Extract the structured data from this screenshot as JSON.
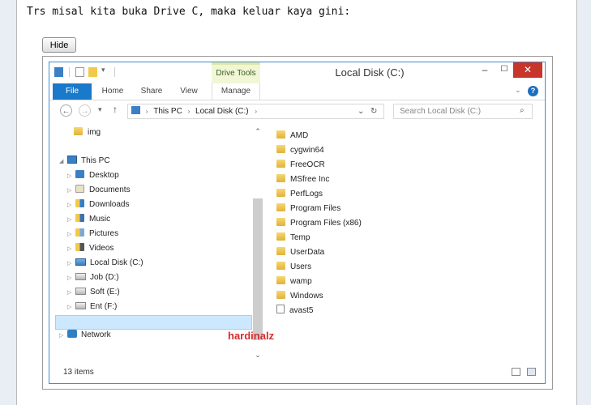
{
  "post": {
    "text": "Trs misal kita buka Drive C, maka keluar kaya gini:"
  },
  "spoiler": {
    "hide_label": "Hide"
  },
  "window": {
    "contextual_tab": "Drive Tools",
    "title": "Local Disk (C:)",
    "controls": {
      "minimize": "–",
      "maximize": "☐",
      "close": "✕"
    },
    "tabs": [
      "File",
      "Home",
      "Share",
      "View",
      "Manage"
    ],
    "help": "?"
  },
  "address": {
    "back": "←",
    "forward": "→",
    "recent": "▾",
    "up": "↑",
    "path": [
      "This PC",
      "Local Disk (C:)"
    ],
    "dropdown": "⌄",
    "refresh": "↻",
    "search_placeholder": "Search Local Disk (C:)"
  },
  "nav_pane": {
    "items": [
      {
        "label": "img"
      },
      {
        "label": "This PC"
      },
      {
        "label": "Desktop"
      },
      {
        "label": "Documents"
      },
      {
        "label": "Downloads"
      },
      {
        "label": "Music"
      },
      {
        "label": "Pictures"
      },
      {
        "label": "Videos"
      },
      {
        "label": "Local Disk (C:)"
      },
      {
        "label": "Job (D:)"
      },
      {
        "label": "Soft (E:)"
      },
      {
        "label": "Ent (F:)"
      },
      {
        "label": "Network"
      }
    ]
  },
  "files": [
    "AMD",
    "cygwin64",
    "FreeOCR",
    "MSfree Inc",
    "PerfLogs",
    "Program Files",
    "Program Files (x86)",
    "Temp",
    "UserData",
    "Users",
    "wamp",
    "Windows",
    "avast5"
  ],
  "watermark": "hardinalz",
  "status": {
    "count": "13 items"
  },
  "colors": {
    "accent": "#1979ca",
    "close": "#c7352b",
    "selection": "#cce8ff",
    "watermark": "#d62b2b"
  }
}
